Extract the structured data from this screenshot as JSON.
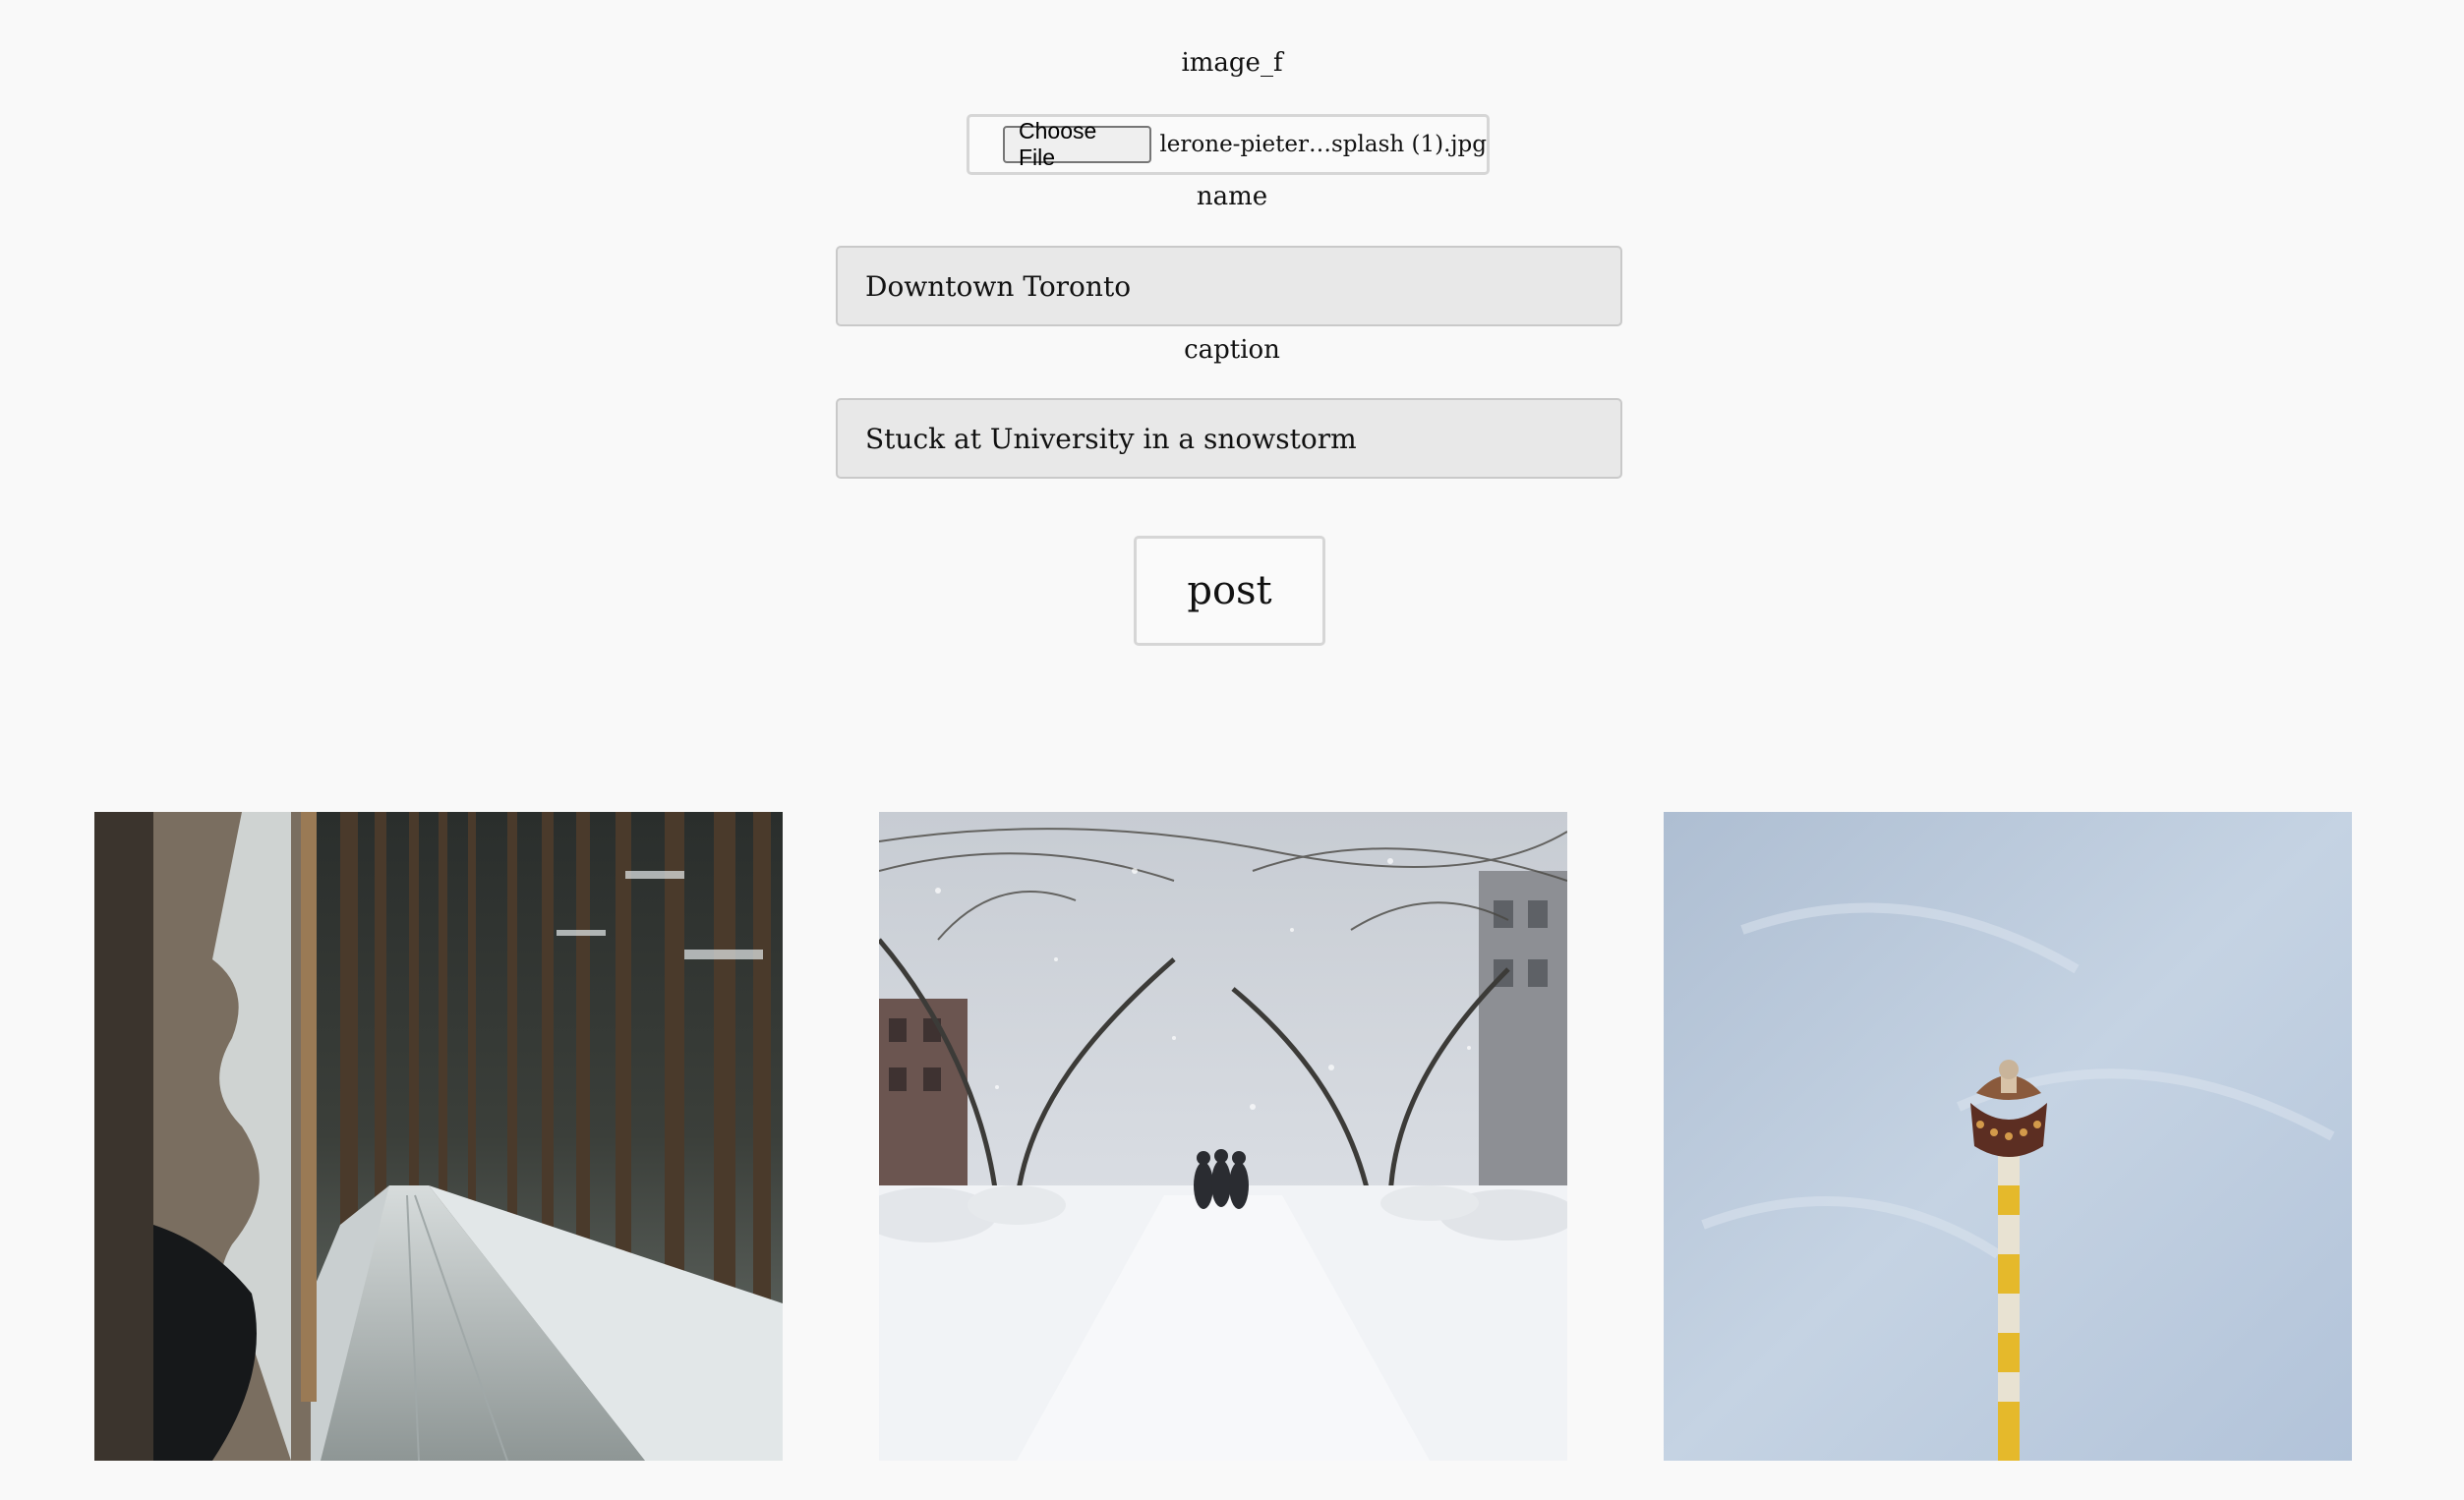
{
  "form": {
    "image_label": "image_f",
    "file": {
      "button_label": "Choose File",
      "selected_file": "lerone-pieter…splash (1).jpg"
    },
    "name_label": "name",
    "name_value": "Downtown Toronto",
    "caption_label": "caption",
    "caption_value": "Stuck at University in a snowstorm",
    "post_label": "post"
  },
  "gallery": {
    "photos": [
      {
        "subject": "snowy forest road with tall trees"
      },
      {
        "subject": "people walking down a snowy city street in a snowstorm"
      },
      {
        "subject": "amusement drop tower ride against a pale blue sky"
      }
    ]
  }
}
